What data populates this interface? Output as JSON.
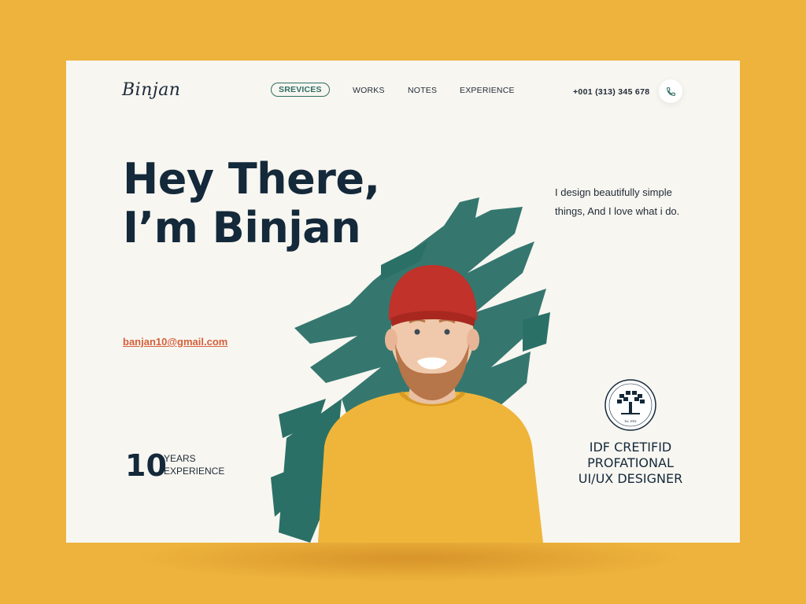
{
  "brand": {
    "logo": "Binjan"
  },
  "nav": {
    "items": [
      {
        "label": "SREVICES",
        "active": true
      },
      {
        "label": "WORKS",
        "active": false
      },
      {
        "label": "NOTES",
        "active": false
      },
      {
        "label": "EXPERIENCE",
        "active": false
      }
    ]
  },
  "contact": {
    "phone": "+001 (313) 345 678",
    "phone_icon": "phone-icon",
    "email": "banjan10@gmail.com"
  },
  "hero": {
    "headline_line1": "Hey There,",
    "headline_line2": "I’m Binjan",
    "tagline_line1": "I design beautifully simple",
    "tagline_line2": "things, And I love what i do."
  },
  "experience": {
    "number": "10",
    "label_line1": "YEARS",
    "label_line2": "EXPERIENCE"
  },
  "certification": {
    "line1": "IDF CRETIFID",
    "line2": "PROFATIONAL",
    "line3": "UI/UX DESIGNER",
    "badge_text": "Est. 2002"
  },
  "colors": {
    "background": "#EDB33C",
    "card": "#F8F6F1",
    "accent": "#2E6E63",
    "link": "#D5603A",
    "text": "#14293A"
  }
}
